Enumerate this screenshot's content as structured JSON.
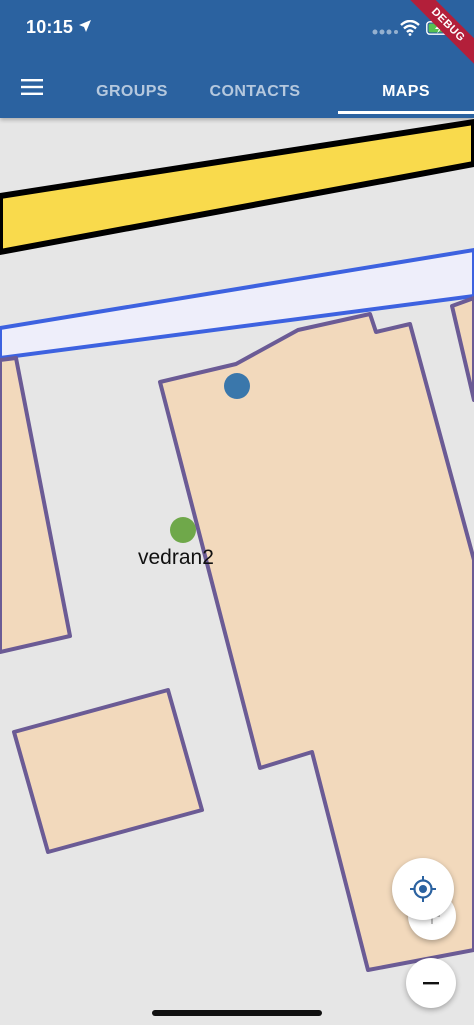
{
  "status_bar": {
    "time": "10:15",
    "location_icon": "location-arrow-icon",
    "signal_icon": "cellular-signal-icon",
    "wifi_icon": "wifi-icon",
    "battery_icon": "battery-charging-icon"
  },
  "debug_banner": "DEBUG",
  "app_bar": {
    "menu_icon": "hamburger-menu-icon",
    "tabs": [
      {
        "label": "GROUPS",
        "active": false
      },
      {
        "label": "CONTACTS",
        "active": false
      },
      {
        "label": "MAPS",
        "active": true
      }
    ],
    "color": "#2b62a0"
  },
  "map": {
    "colors": {
      "background": "#e6e6e6",
      "road_major_fill": "#f9da4c",
      "road_major_outline": "#000000",
      "road_minor_fill": "#eeeefa",
      "road_minor_outline": "#3d62e0",
      "building_fill": "#f2d9bc",
      "building_outline": "#6b5b95"
    },
    "markers": [
      {
        "name": "",
        "color": "#3a77ab"
      },
      {
        "name": "vedran2",
        "color": "#6fa84a"
      }
    ]
  },
  "controls": {
    "locate_icon": "my-location-icon",
    "zoom_in_icon": "plus-icon",
    "zoom_out_icon": "minus-icon"
  }
}
